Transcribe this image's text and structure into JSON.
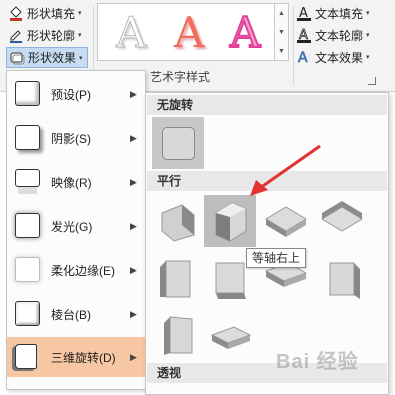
{
  "ribbon": {
    "shape_fill_label": "形状填充",
    "shape_outline_label": "形状轮廓",
    "shape_effects_label": "形状效果",
    "text_fill_label": "文本填充",
    "text_outline_label": "文本轮廓",
    "text_effects_label": "文本效果",
    "wordart_group_label": "艺术字样式",
    "wordart_sample_1": "A",
    "wordart_sample_2": "A",
    "wordart_sample_3": "A",
    "dropdown_glyph": "▾"
  },
  "effects_menu": {
    "items": [
      {
        "label": "预设(P)"
      },
      {
        "label": "阴影(S)"
      },
      {
        "label": "映像(R)"
      },
      {
        "label": "发光(G)"
      },
      {
        "label": "柔化边缘(E)"
      },
      {
        "label": "棱台(B)"
      },
      {
        "label": "三维旋转(D)"
      }
    ],
    "submenu_arrow": "▶"
  },
  "rotation_panel": {
    "section_no_rotation": "无旋转",
    "section_parallel": "平行",
    "section_perspective": "透视",
    "tooltip": "等轴右上"
  },
  "watermark": "Bai 经验"
}
